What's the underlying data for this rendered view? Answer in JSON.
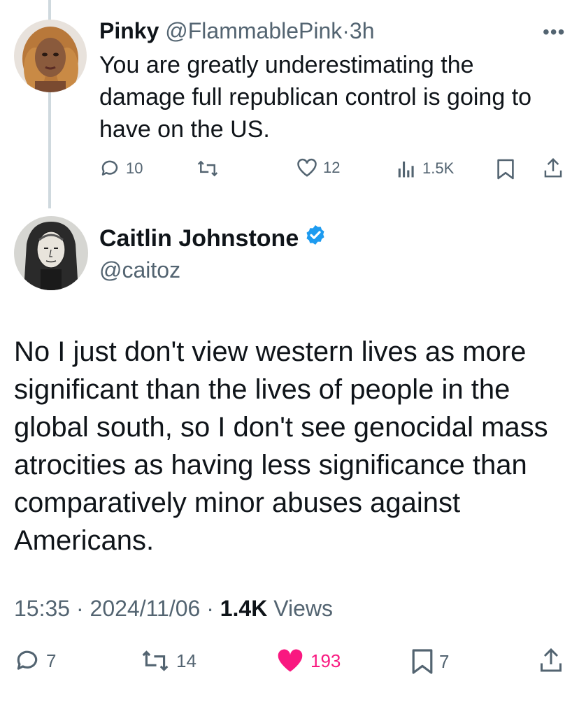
{
  "reply": {
    "name": "Pinky",
    "handle": "@FlammablePink",
    "separator": "·",
    "time": "3h",
    "text": "You are greatly underestimating the damage full republican control is going to have on the US.",
    "actions": {
      "replies": "10",
      "reposts": "",
      "likes": "12",
      "views": "1.5K"
    }
  },
  "main_tweet": {
    "name": "Caitlin Johnstone",
    "handle": "@caitoz",
    "verified": true,
    "text": "No I just don't view western lives as more significant than the lives of people in the global south, so I don't see genocidal mass atrocities as having less significance than comparatively minor abuses against Americans.",
    "time": "15:35",
    "date": "2024/11/06",
    "sep": "·",
    "views_count": "1.4K",
    "views_label": "Views",
    "actions": {
      "replies": "7",
      "reposts": "14",
      "likes": "193",
      "bookmarks": "7"
    }
  },
  "colors": {
    "text_primary": "#0f1419",
    "text_secondary": "#536471",
    "like_active": "#f91880",
    "verified_blue": "#1d9bf0",
    "thread_line": "#cfd9de"
  },
  "icons": [
    "reply-icon",
    "repost-icon",
    "like-icon",
    "views-icon",
    "bookmark-icon",
    "share-icon",
    "more-icon",
    "verified-badge-icon"
  ]
}
